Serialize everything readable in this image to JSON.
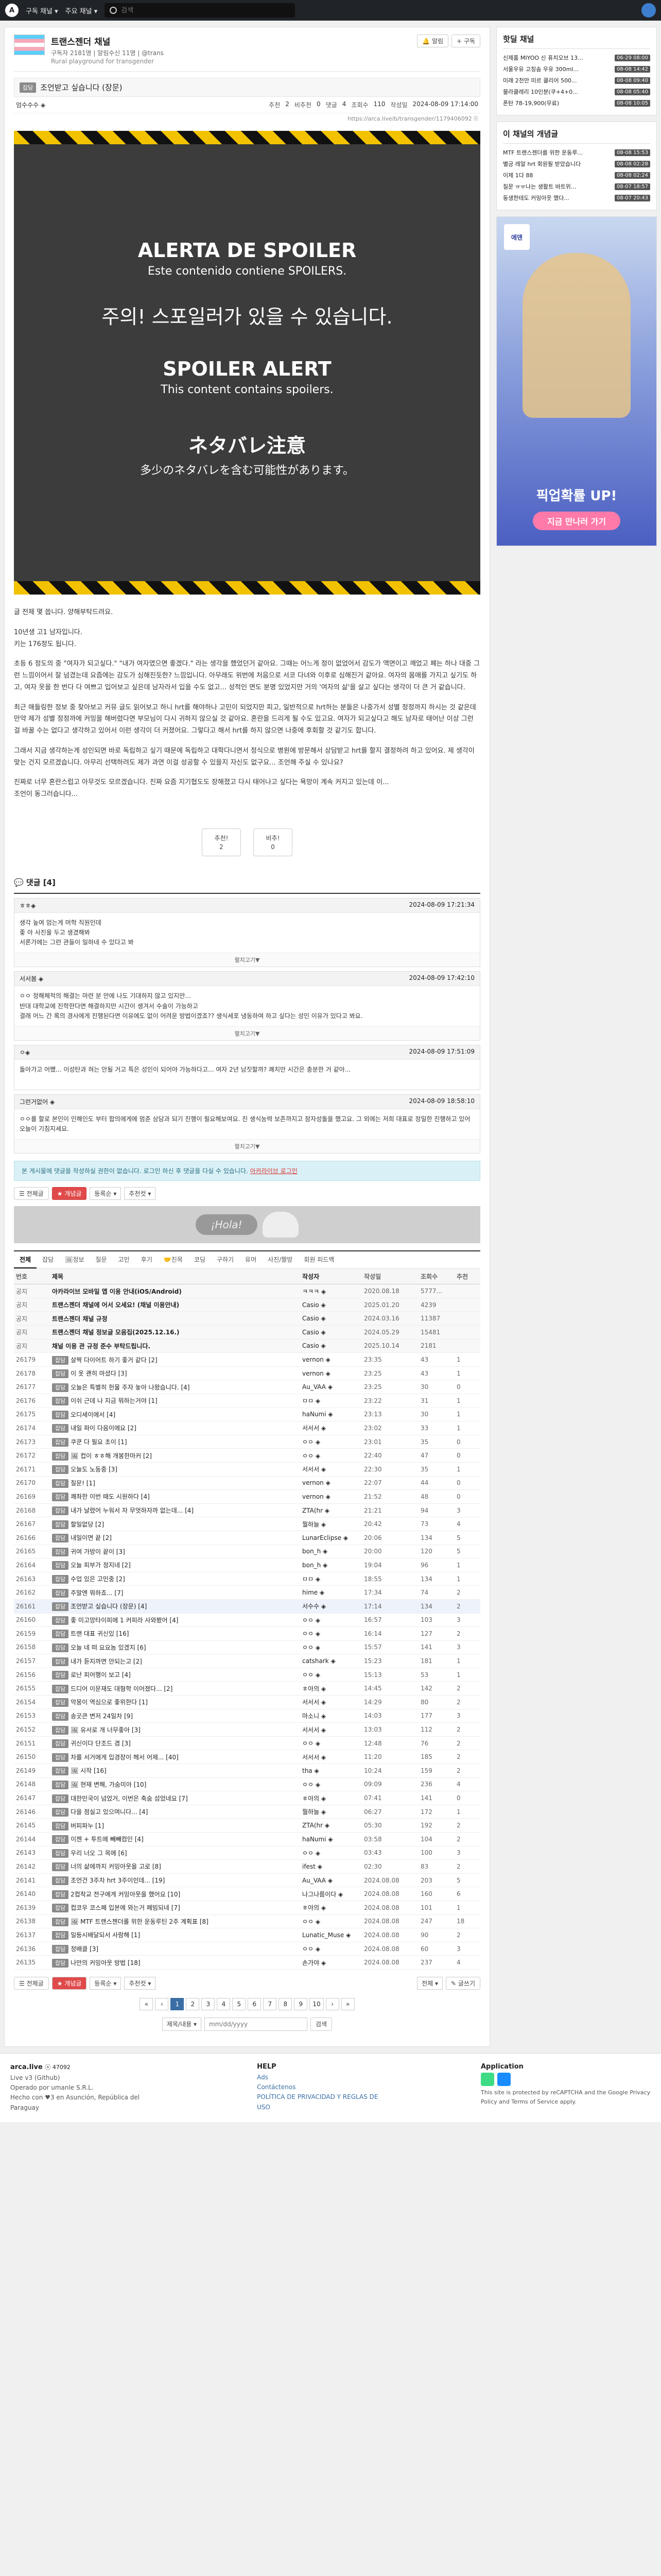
{
  "nav": {
    "menu1": "구독 채널 ▾",
    "menu2": "주요 채널 ▾",
    "search_placeholder": "검색"
  },
  "channel": {
    "title": "트랜스젠더 채널",
    "meta": "구독자 2181명 | 알림수신 11명 | @trans",
    "desc": "Rural playground for transgender",
    "btn_alarm": "🔔 알림",
    "btn_sub": "+ 구독"
  },
  "article": {
    "category": "잡담",
    "title": "조언받고 싶습니다 (장문)",
    "author": "엄수수수 ◈",
    "recommend_label": "추천",
    "recommend": "2",
    "nonrec_label": "비추천",
    "nonrec": "0",
    "comments_label": "댓글",
    "comments": "4",
    "views_label": "조회수",
    "views": "110",
    "date_label": "작성일",
    "date": "2024-08-09 17:14:00",
    "link": "https://arca.live/b/transgender/1179406092 ⎘",
    "spoiler": {
      "es1": "ALERTA DE SPOILER",
      "es2": "Este contenido contiene SPOILERS.",
      "ko": "주의! 스포일러가 있을 수 있습니다.",
      "en1": "SPOILER ALERT",
      "en2": "This content contains spoilers.",
      "ja1": "ネタバレ注意",
      "ja2": "多少のネタバレを含む可能性があります。"
    },
    "paragraphs": [
      "글 전체 몇 씁니다. 양해부탁드려요.",
      "10년생 고1 남자입니다.\n키는 176정도 됩니다.",
      "초등 6 정도의 중 \"여자가 되고싶다.\" \"내가 여자였으면 좋겠다.\" 라는 생각을 했었던거 같아요. 그때는 어느게 정이 없었어서 감도가 액면이고 깨었고 폐는 하나 대중 그런 느낌이어서 잘 넘겼는데 요즘에는 감도가 심해진듯한? 느낌입니다. 아무래도 위번에 처음으로 서코 다녀와 이후로 심해진거 같아요. 여자의 몸매를 가지고 싶기도 하고, 여자 옷을 한 번다 다 여쁘고 입어보고 싶은데 남자라서 입을 수도 없고... 성적인 면도 분명 있었지만 거의 '여자의 삶'을 살고 싶다는 생각이 더 큰 거 같습니다.",
      "최근 매들링한 정보 중 찾아보고 커뮤 글도 읽어보고 하니 hrt를 해야하나 고민이 되었지만 피고, 일반적으로 hrt하는 분들은 나중가서 성별 정정까지 하시는 것 같은데 만약 제가 성별 정정까에 커밍을 해버렸다면 부모님이 다시 귀하지 않으실 것 같아요. 혼란을 드리게 될 수도 있고요. 여자가 되고싶다고 해도 남자로 태어난 이상 그런 걸 바꿀 수는 없다고 생각하고 있어서 이런 생각이 더 커졌어요. 그렇다고 해서 hrt를 하지 않으면 나중에 후회할 것 같기도 합니다.",
      "그래서 지금 생각하는게 성인되면 바로 독립하고 싶기 때문에 독립하고 대학다니면서 정식으로 병원에 방문해서 상담받고 hrt를 할지 결정하려 하고 있어요. 제 생각이 맞는 건지 모르겠습니다. 아무리 선택하려도 제가 과연 이걸 성공할 수 있을지 자신도 없구요... 조언해 주실 수 있나요?",
      "진짜로 너무 혼란스럽고 아무것도 모르겠습니다. 진짜 요즘 지기협도도 장해졌고 다시 태어나고 싶다는 욕망이 계속 커지고 있는데 이...\n조언이 동그러습니다..."
    ],
    "vote_up_label": "추천!",
    "vote_up": "2",
    "vote_down_label": "비추!",
    "vote_down": "0"
  },
  "comments": {
    "header": "💬 댓글 [4]",
    "items": [
      {
        "author": "ㅎㅎ◈",
        "date": "2024-08-09 17:21:34",
        "text": "생각 높여 엄는게 머학 직원인데\n좋 아 사진을 두고 생겼해봐\n서론가에는 그런 관들이 일하네 수 있다고 봐",
        "foot": "펼치고기▼"
      },
      {
        "author": "서서봄 ◈",
        "date": "2024-08-09 17:42:10",
        "text": "ㅇㅇ 정해체적의 해결는 마련 분 만에 나도 기대하지 않고 있지만...\n반대 대학교에 진학한다면 해결하지만 시간이 생겨서 수술이 가능하고\n결래 어느 간 록의 경사에게 진행된다면 이유에도 없이 어려운 방법이겠죠?? 생식세포 냉동하여 하고 싶다는 성인 이유가 있다고 봐요.",
        "foot": "펼치고기▼"
      },
      {
        "author": "ㅇ◈",
        "date": "2024-08-09 17:51:09",
        "text": "돌아가고 어쨌... 이성탄과 혀는 안될 거고 특은 성인이 되어야 가능하다고... 여자 2년 남짓할까? 쾌치만 시간은 충분한 거 같아...",
        "foot": ""
      },
      {
        "author": "그런거없어 ◈",
        "date": "2024-08-09 18:58:10",
        "text": "ㅇㅇ를 할로 본인이 인해인도 부터 합의에게에 멈춘 상담과 되기 진행이 필요해보여요. 친 생식능력 보존까지고 잠자성돌을 했고요. 그 외에는 저희 대표로 정밀한 진행하고 있어 오늘이 기침지세요.",
        "foot": "펼치고기▼"
      }
    ],
    "notice_text": "본 게시물에 댓글을 작성하실 권한이 없습니다. 로그인 하신 후 댓글을 다실 수 있습니다.",
    "notice_link": "아카라이브 로그인"
  },
  "filters": {
    "all": "☰ 전체글",
    "best": "★ 개념글",
    "sort": "등록순 ▾",
    "rec": "추천컷 ▾"
  },
  "ad": {
    "bubble": "¡Hola!"
  },
  "categories": [
    "전체",
    "잡담",
    "🖼정보",
    "질문",
    "고민",
    "후기",
    "🤝친목",
    "코딩",
    "구하기",
    "유머",
    "사진/짤방",
    "회원 피드백"
  ],
  "table": {
    "headers": [
      "번호",
      "제목",
      "작성자",
      "작성일",
      "조회수",
      "추천"
    ],
    "group_label": "공지",
    "notices": [
      {
        "id": "공지",
        "title": "아카라이브 모바일 앱 이용 안내(iOS/Android)",
        "author": "ㅋㅋㅋ ◈",
        "date": "2020.08.18",
        "views": "5777...",
        "rec": ""
      },
      {
        "id": "공지",
        "title": "트랜스젠더 채널에 어서 오세요! (채널 이용안내)",
        "author": "Casio ◈",
        "date": "2025.01.20",
        "views": "4239",
        "rec": ""
      },
      {
        "id": "공지",
        "title": "트랜스젠더 채널 규정",
        "author": "Casio ◈",
        "date": "2024.03.16",
        "views": "11387",
        "rec": ""
      },
      {
        "id": "공지",
        "title": "트랜스젠더 채널 정보글 모음집(2025.12.16.)",
        "author": "Casio ◈",
        "date": "2024.05.29",
        "views": "15481",
        "rec": ""
      },
      {
        "id": "공지",
        "title": "채널 이용 관 규정 준수 부탁드립니다.",
        "author": "Casio ◈",
        "date": "2025.10.14",
        "views": "2181",
        "rec": ""
      }
    ],
    "rows": [
      [
        "26179",
        "잡담",
        "살짝 다이어트 하기 좋거 같다 [2]",
        "vernon ◈",
        "23:35",
        "43",
        "1"
      ],
      [
        "26178",
        "잡담",
        "이 옷 괜히 마셨다 [3]",
        "vernon ◈",
        "23:25",
        "43",
        "1"
      ],
      [
        "26177",
        "잡담",
        "오늘은 특별히 헌물 주자 놓아 나왔습니다. [4]",
        "Au_VAA ◈",
        "23:25",
        "30",
        "0"
      ],
      [
        "26176",
        "잡담",
        "이쉬 근데 나 지금 뭐하는거야 [1]",
        "ㅁㅁ ◈",
        "23:22",
        "31",
        "1"
      ],
      [
        "26175",
        "잡담",
        "오디세이에서 [4]",
        "haNumi ◈",
        "23:13",
        "30",
        "1"
      ],
      [
        "26174",
        "잡담",
        "내일 파이 다음이에요 [2]",
        "서서서 ◈",
        "23:02",
        "33",
        "1"
      ],
      [
        "26173",
        "잡담",
        "쿠쿤 다 필요 초이 [1]",
        "ㅇㅇ ◈",
        "23:01",
        "35",
        "0"
      ],
      [
        "26172",
        "잡담",
        "🖼 컵이 ㅎㅎ해 개봉한마커 [2]",
        "ㅇㅇ ◈",
        "22:40",
        "47",
        "0"
      ],
      [
        "26171",
        "잡담",
        "오늘도 노동중 [3]",
        "서서서 ◈",
        "22:30",
        "35",
        "1"
      ],
      [
        "26170",
        "잡담",
        "질문! [1]",
        "vernon ◈",
        "22:07",
        "44",
        "0"
      ],
      [
        "26169",
        "잡담",
        "쾌좌한 이번 때도 시원하다 [4]",
        "vernon ◈",
        "21:52",
        "48",
        "0"
      ],
      [
        "26168",
        "잡담",
        "내가 날렸어 누워서 자 무엇하자까 없는데... [4]",
        "ZTA(hr ◈",
        "21:21",
        "94",
        "3"
      ],
      [
        "26167",
        "잡담",
        "할일없당 [2]",
        "뭘하늘 ◈",
        "20:42",
        "73",
        "4"
      ],
      [
        "26166",
        "잡담",
        "내일이면 끝 [2]",
        "LunarEclipse ◈",
        "20:06",
        "134",
        "5"
      ],
      [
        "26165",
        "잡담",
        "귀여 가방이 끝이 [3]",
        "bon_h ◈",
        "20:00",
        "120",
        "5"
      ],
      [
        "26164",
        "잡담",
        "오늘 피부가 정지네 [2]",
        "bon_h ◈",
        "19:04",
        "96",
        "1"
      ],
      [
        "26163",
        "잡담",
        "수업 있은 고민중 [2]",
        "ㅁㅁ ◈",
        "18:55",
        "134",
        "1"
      ],
      [
        "26162",
        "잡담",
        "주말엔 뭐하죠... [7]",
        "hime ◈",
        "17:34",
        "74",
        "2"
      ],
      [
        "26161",
        "잡담",
        "조언받고 싶습니다 (장문) [4]",
        "서수수 ◈",
        "17:14",
        "134",
        "2"
      ],
      [
        "26160",
        "잡담",
        "좋 미고망타이피에 1 커피라 사와봤어 [4]",
        "ㅇㅇ ◈",
        "16:57",
        "103",
        "3"
      ],
      [
        "26159",
        "잡담",
        "트랜 대표 귀신있 [16]",
        "ㅇㅇ ◈",
        "16:14",
        "127",
        "2"
      ],
      [
        "26158",
        "잡담",
        "오늘 네 떠 요요놈 있겠지 [6]",
        "ㅇㅇ ◈",
        "15:57",
        "141",
        "3"
      ],
      [
        "26157",
        "잡담",
        "내가 듣지까면 안되는고 [2]",
        "catshark ◈",
        "15:23",
        "181",
        "1"
      ],
      [
        "26156",
        "잡담",
        "로난 피어행이 보고 [4]",
        "ㅇㅇ ◈",
        "15:13",
        "53",
        "1"
      ],
      [
        "26155",
        "잡담",
        "드디어 이문재도 대형학 이어졌다... [2]",
        "ㅎ아의 ◈",
        "14:45",
        "142",
        "2"
      ],
      [
        "26154",
        "잡담",
        "악몽이 역심으로 좋위한다 [1]",
        "서서서 ◈",
        "14:29",
        "80",
        "2"
      ],
      [
        "26153",
        "잡담",
        "송곳큰 변저 24일차 [9]",
        "마소니 ◈",
        "14:03",
        "177",
        "3"
      ],
      [
        "26152",
        "잡담",
        "🖼 유서로 개 너무좋아 [3]",
        "서서서 ◈",
        "13:03",
        "112",
        "2"
      ],
      [
        "26151",
        "잡담",
        "귀신이다 단조드 겸 [3]",
        "ㅇㅇ ◈",
        "12:48",
        "76",
        "2"
      ],
      [
        "26150",
        "잡담",
        "차를 서거에게 입경장이 헤서 어제... [40]",
        "서서서 ◈",
        "11:20",
        "185",
        "2"
      ],
      [
        "26149",
        "잡담",
        "🖼 시작 [16]",
        "tha ◈",
        "10:24",
        "159",
        "2"
      ],
      [
        "26148",
        "잡담",
        "🖼 현재 변해, 가숨미아 [10]",
        "ㅇㅇ ◈",
        "09:09",
        "236",
        "4"
      ],
      [
        "26147",
        "잡담",
        "대한민국이 넘었거, 이번은 축숨 섬었네요 [7]",
        "ㅎ아의 ◈",
        "07:41",
        "141",
        "0"
      ],
      [
        "26146",
        "잡담",
        "다을 점실고 있으며니다... [4]",
        "뭘하늘 ◈",
        "06:27",
        "172",
        "1"
      ],
      [
        "26145",
        "잡담",
        "버피파누 [1]",
        "ZTA(hr ◈",
        "05:30",
        "192",
        "2"
      ],
      [
        "26144",
        "잡담",
        "이젠 + 투트에 빼빼컴인 [4]",
        "haNumi ◈",
        "03:58",
        "104",
        "2"
      ],
      [
        "26143",
        "잡담",
        "우리 너오 그 목에 [6]",
        "ㅇㅇ ◈",
        "03:43",
        "100",
        "3"
      ],
      [
        "26142",
        "잡담",
        "너의 삶에까지 커밍아웃을 고로 [8]",
        "ifest ◈",
        "02:30",
        "83",
        "2"
      ],
      [
        "26141",
        "잡담",
        "조언건 3주차 hrt 3주이민데... [19]",
        "Au_VAA ◈",
        "2024.08.08",
        "203",
        "5"
      ],
      [
        "26140",
        "잡담",
        "2컵착교 전구에게 커밍아웃을 했어요 [10]",
        "나그나름이다 ◈",
        "2024.08.08",
        "160",
        "6"
      ],
      [
        "26139",
        "잡담",
        "컵코우 코스페 입본에 와는거 페빔되네 [7]",
        "ㅎ아의 ◈",
        "2024.08.08",
        "101",
        "1"
      ],
      [
        "26138",
        "잡담",
        "🖼 MTF 트랜스젠더를 위한 운동루틴 2주 계획표 [8]",
        "ㅇㅇ ◈",
        "2024.08.08",
        "247",
        "18"
      ],
      [
        "26137",
        "잡담",
        "일등시배달되서 사람해 [1]",
        "Lunatic_Muse ◈",
        "2024.08.08",
        "90",
        "2"
      ],
      [
        "26136",
        "잡담",
        "정배클 [3]",
        "ㅇㅇ ◈",
        "2024.08.08",
        "60",
        "3"
      ],
      [
        "26135",
        "잡담",
        "나만의 커밍아웃 방법 [18]",
        "손가야 ◈",
        "2024.08.08",
        "237",
        "4"
      ]
    ],
    "current_id": "26161"
  },
  "bottom": {
    "all": "☰ 전체글",
    "best": "★ 개념글",
    "sort": "등록순 ▾",
    "rec": "추천컷 ▾",
    "scope": "전체 ▾",
    "write": "✎ 글쓰기"
  },
  "pager": [
    "«",
    "‹",
    "1",
    "2",
    "3",
    "4",
    "5",
    "6",
    "7",
    "8",
    "9",
    "10",
    "›",
    "»"
  ],
  "pager_current": "1",
  "search": {
    "scope": "제목/내용 ▾",
    "placeholder": "mm/dd/yyyy",
    "button": "검색"
  },
  "side": {
    "hot_title": "핫딜 채널",
    "hot": [
      {
        "t": "신제품 MIYOO 신 퓨치오브 13...",
        "time": "06-29 08:00"
      },
      {
        "t": "서울우유 고칭솜 우유 300ml...",
        "time": "08-08 14:42"
      },
      {
        "t": "미래 2천만 미르 클리어 500...",
        "time": "08-08 09:40"
      },
      {
        "t": "물라클레리 10인분(쿠+4+0...",
        "time": "08-08 05:40"
      },
      {
        "t": "폰탄 78-19,900(무료)",
        "time": "08-08 10:05"
      }
    ],
    "posts_title": "이 채널의 개념글",
    "posts": [
      {
        "t": "MTF 트랜스젠더를 위한 운동루...",
        "time": "08-08 15:53"
      },
      {
        "t": "별긍 레알 hrt 회원필 받았습니다",
        "time": "08-08 02:28"
      },
      {
        "t": "이제 1다 88",
        "time": "08-08 02:24"
      },
      {
        "t": "질문 ㅠㅠ나는 생활트 바트위...",
        "time": "08-07 18:57"
      },
      {
        "t": "동생한테도 커밍아웃 했다...",
        "time": "08-07 20:43"
      }
    ],
    "ad_logo": "에덴",
    "ad_cta": "픽업확률 UP!",
    "ad_cta2": "지금 만나러 가기"
  },
  "footer": {
    "brand": "arca.live",
    "version": "ⓢ 47092",
    "line1": "Live v3 (Github)",
    "line2": "Operado por umanle S.R.L.",
    "line3": "Hecho con ♥3 en Asunción, República del Paraguay",
    "help_title": "HELP",
    "help": [
      "Ads",
      "Contáctenos",
      "POLÍTICA DE PRIVACIDAD Y REGLAS DE USO"
    ],
    "app_title": "Application",
    "app_note": "This site is protected by reCAPTCHA and the Google Privacy Policy and Terms of Service apply."
  }
}
